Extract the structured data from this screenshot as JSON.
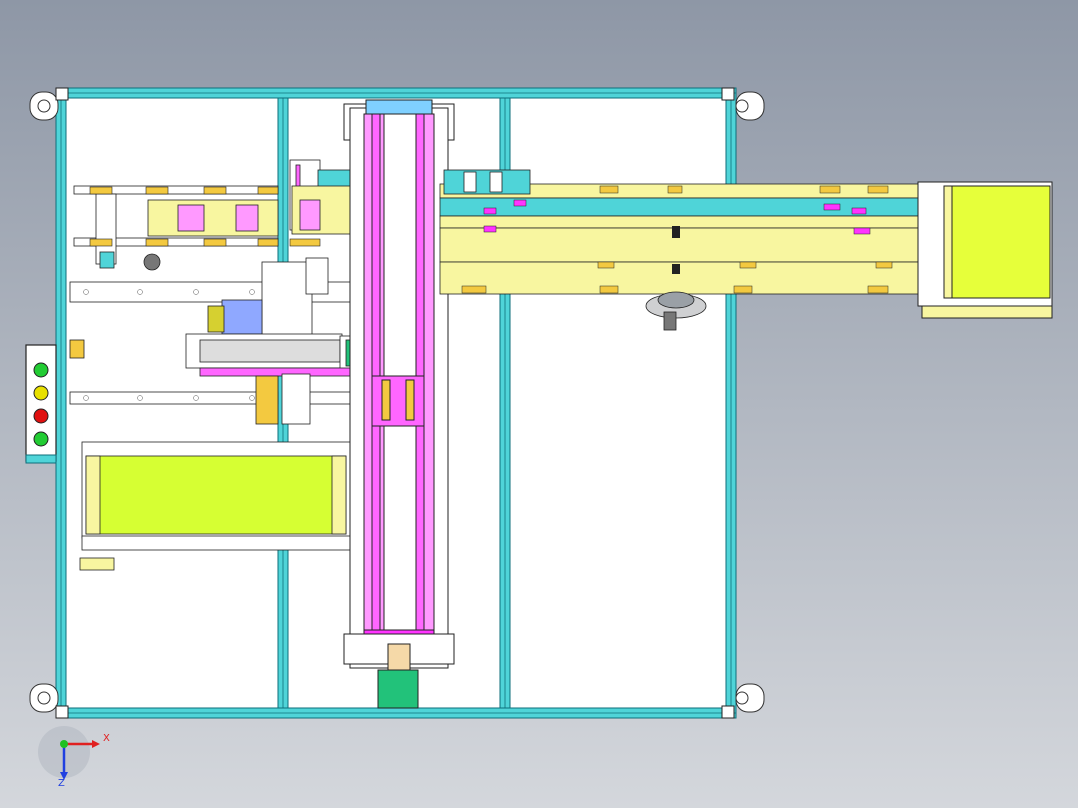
{
  "viewport": {
    "background_top": "#8e97a6",
    "background_bottom": "#d4d7dc"
  },
  "colors": {
    "frame_cyan": "#4fd4d8",
    "frame_dark": "#0e6e7a",
    "panel_white": "#ffffff",
    "conveyor_yellow": "#f8f6a0",
    "belt_green": "#d6ff33",
    "magenta": "#ff66ff",
    "light_blue": "#7fd0ff",
    "beige": "#f5d9a8",
    "signal_green": "#22cc33",
    "signal_amber": "#e8e000",
    "signal_red": "#e01010",
    "motor_green": "#22c27a"
  },
  "signal_tower": {
    "lights": [
      {
        "name": "green",
        "color": "#22cc33"
      },
      {
        "name": "amber",
        "color": "#e8e000"
      },
      {
        "name": "red",
        "color": "#e01010"
      },
      {
        "name": "green",
        "color": "#22cc33"
      }
    ]
  },
  "triad": {
    "x_label": "X",
    "z_label": "Z",
    "x_color": "#e02020",
    "y_color": "#20c020",
    "z_color": "#2040e0"
  }
}
